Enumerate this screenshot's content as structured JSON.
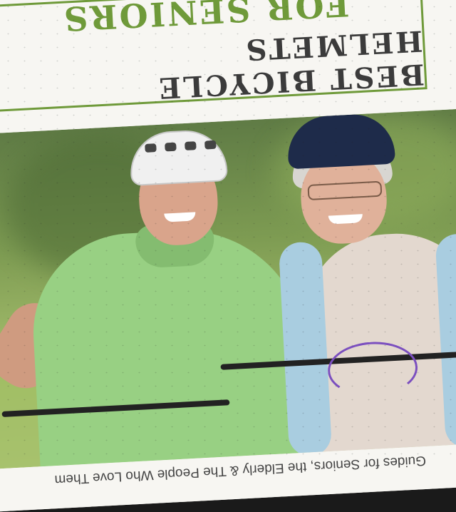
{
  "poster": {
    "title_line1": "BEST BICYCLE HELMETS",
    "title_line2": "FOR SENIORS",
    "tagline": "Guides for Seniors, the Elderly & The People Who Love Them",
    "colors": {
      "accent_green": "#6f9a3a",
      "title_dark": "#3b3b3b",
      "background": "#f7f6f2"
    }
  }
}
